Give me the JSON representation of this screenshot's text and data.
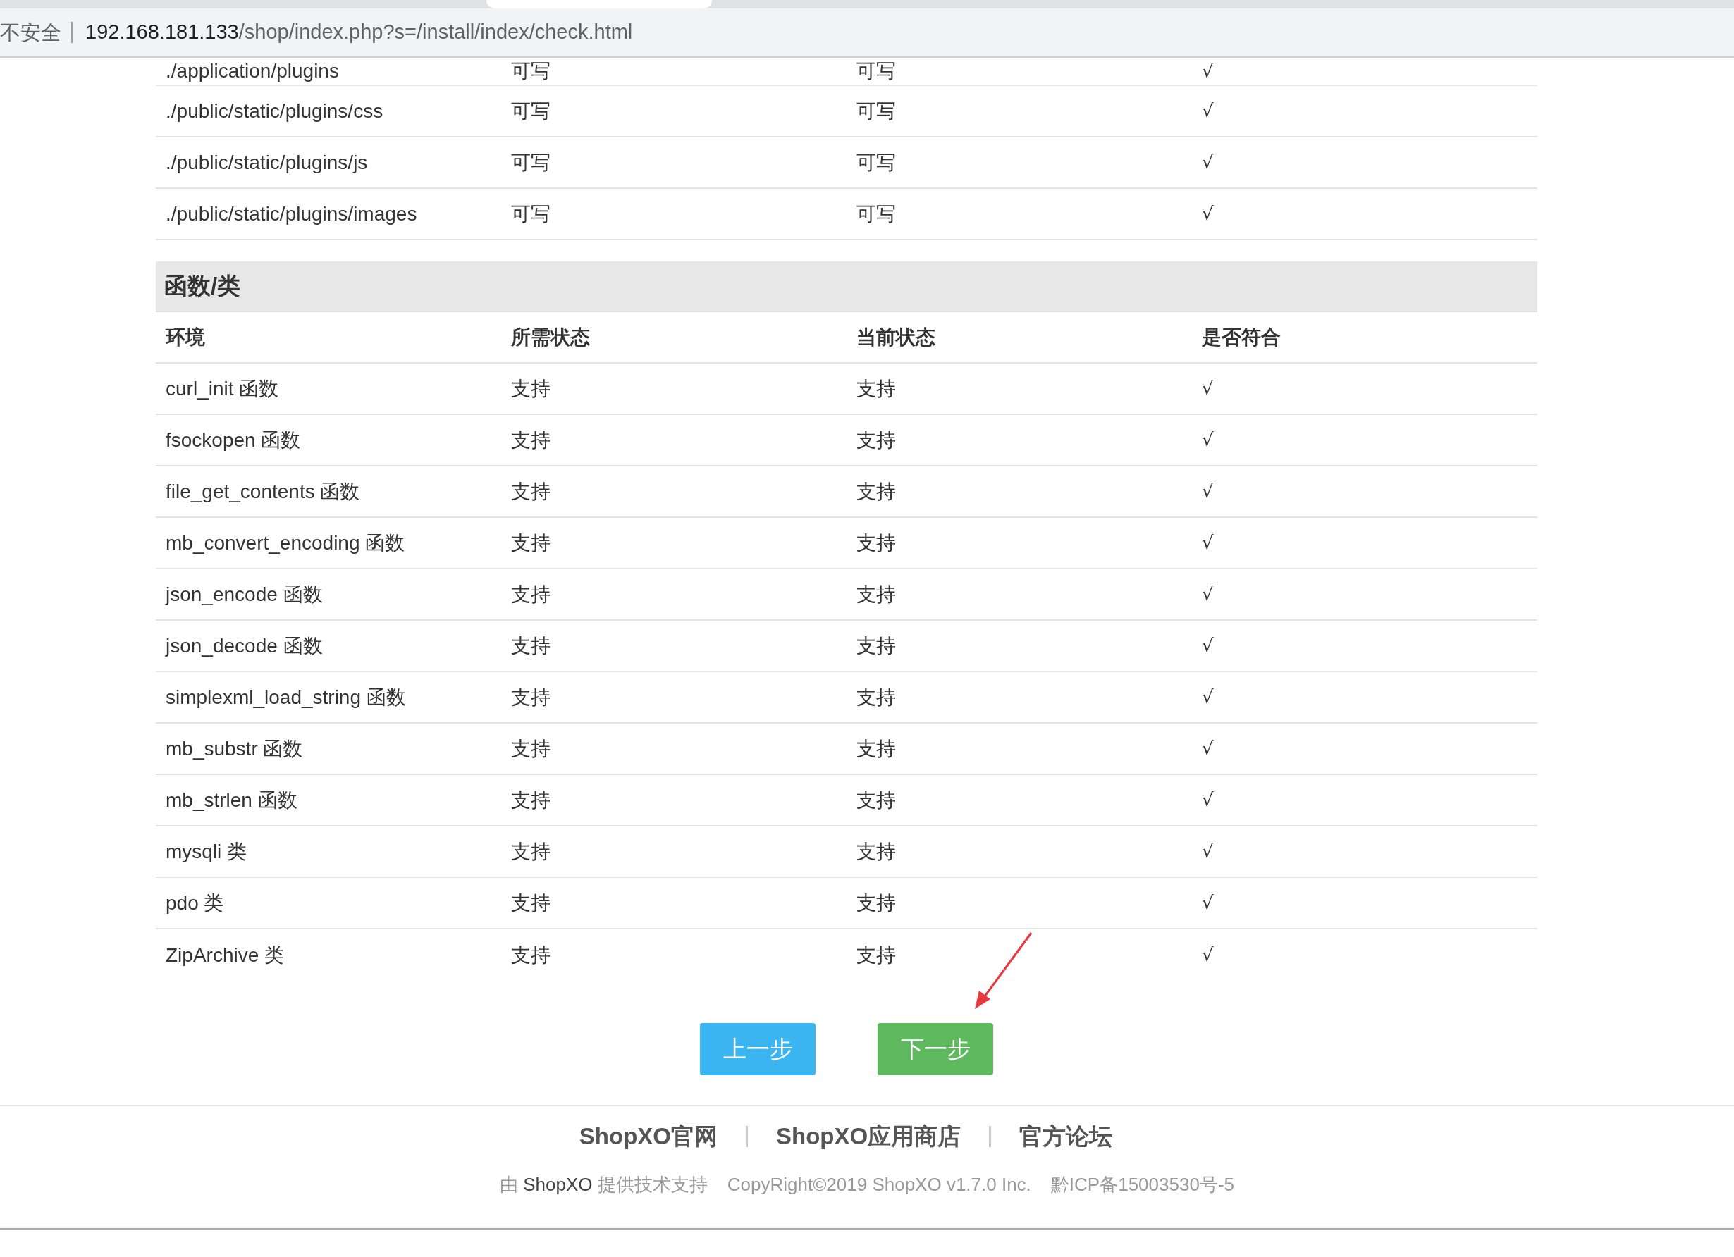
{
  "browser": {
    "security_label": "不安全",
    "url_host": "192.168.181.133",
    "url_path": "/shop/index.php?s=/install/index/check.html"
  },
  "dir_section": {
    "rows": [
      {
        "env": "./application/plugins",
        "required": "可写",
        "current": "可写",
        "match": "√"
      },
      {
        "env": "./public/static/plugins/css",
        "required": "可写",
        "current": "可写",
        "match": "√"
      },
      {
        "env": "./public/static/plugins/js",
        "required": "可写",
        "current": "可写",
        "match": "√"
      },
      {
        "env": "./public/static/plugins/images",
        "required": "可写",
        "current": "可写",
        "match": "√"
      }
    ]
  },
  "func_section": {
    "title": "函数/类",
    "columns": [
      "环境",
      "所需状态",
      "当前状态",
      "是否符合"
    ],
    "rows": [
      {
        "env": "curl_init 函数",
        "required": "支持",
        "current": "支持",
        "match": "√"
      },
      {
        "env": "fsockopen 函数",
        "required": "支持",
        "current": "支持",
        "match": "√"
      },
      {
        "env": "file_get_contents 函数",
        "required": "支持",
        "current": "支持",
        "match": "√"
      },
      {
        "env": "mb_convert_encoding 函数",
        "required": "支持",
        "current": "支持",
        "match": "√"
      },
      {
        "env": "json_encode 函数",
        "required": "支持",
        "current": "支持",
        "match": "√"
      },
      {
        "env": "json_decode 函数",
        "required": "支持",
        "current": "支持",
        "match": "√"
      },
      {
        "env": "simplexml_load_string 函数",
        "required": "支持",
        "current": "支持",
        "match": "√"
      },
      {
        "env": "mb_substr 函数",
        "required": "支持",
        "current": "支持",
        "match": "√"
      },
      {
        "env": "mb_strlen 函数",
        "required": "支持",
        "current": "支持",
        "match": "√"
      },
      {
        "env": "mysqli 类",
        "required": "支持",
        "current": "支持",
        "match": "√"
      },
      {
        "env": "pdo 类",
        "required": "支持",
        "current": "支持",
        "match": "√"
      },
      {
        "env": "ZipArchive 类",
        "required": "支持",
        "current": "支持",
        "match": "√"
      }
    ]
  },
  "buttons": [
    {
      "label": "上一步",
      "kind": "prev"
    },
    {
      "label": "下一步",
      "kind": "next"
    }
  ],
  "footer": {
    "links": [
      "ShopXO官网",
      "ShopXO应用商店",
      "官方论坛"
    ],
    "credit": {
      "before": "由",
      "link": "ShopXO",
      "after": "提供技术支持"
    },
    "copyright": "CopyRight©2019 ShopXO v1.7.0 Inc.",
    "icp": "黔ICP备15003530号-5"
  }
}
